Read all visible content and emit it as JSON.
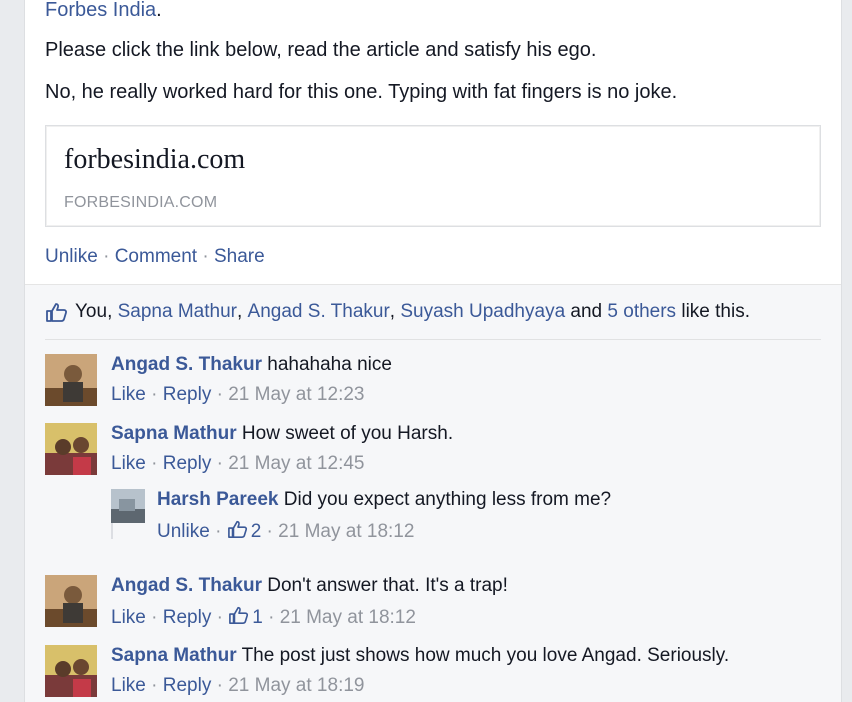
{
  "post": {
    "line1_link": "Forbes India",
    "line1_tail": ".",
    "line2": "Please click the link below, read the article and satisfy his ego.",
    "line3": "No, he really worked hard for this one. Typing with fat fingers is no joke.",
    "share": {
      "title": "forbesindia.com",
      "domain": "FORBESINDIA.COM"
    },
    "actions": {
      "unlike": "Unlike",
      "comment": "Comment",
      "share": "Share",
      "sep": " · "
    }
  },
  "likes": {
    "you": "You,",
    "names": [
      "Sapna Mathur",
      "Angad S. Thakur",
      "Suyash Upadhyaya"
    ],
    "comma": ",",
    "and": "and",
    "others": "5 others",
    "tail": "like this."
  },
  "comments": [
    {
      "author": "Angad S. Thakur",
      "text": "hahahaha nice",
      "like": "Like",
      "reply": "Reply",
      "likes": "",
      "time": "21 May at 12:23"
    },
    {
      "author": "Sapna Mathur",
      "text": "How sweet of you Harsh.",
      "like": "Like",
      "reply": "Reply",
      "likes": "",
      "time": "21 May at 12:45"
    },
    {
      "author": "Harsh Pareek",
      "text": "Did you expect anything less from me?",
      "like": "Unlike",
      "reply": "",
      "likes": "2",
      "time": "21 May at 18:12"
    },
    {
      "author": "Angad S. Thakur",
      "text": "Don't answer that. It's a trap!",
      "like": "Like",
      "reply": "Reply",
      "likes": "1",
      "time": "21 May at 18:12"
    },
    {
      "author": "Sapna Mathur",
      "text": "The post just shows how much you love Angad. Seriously.",
      "like": "Like",
      "reply": "Reply",
      "likes": "",
      "time": "21 May at 18:19"
    }
  ],
  "colors": {
    "link": "#3b5998",
    "meta": "#90949c",
    "ufi_bg": "#f6f7f9"
  },
  "icons": {
    "like": "thumbs-up-icon"
  }
}
